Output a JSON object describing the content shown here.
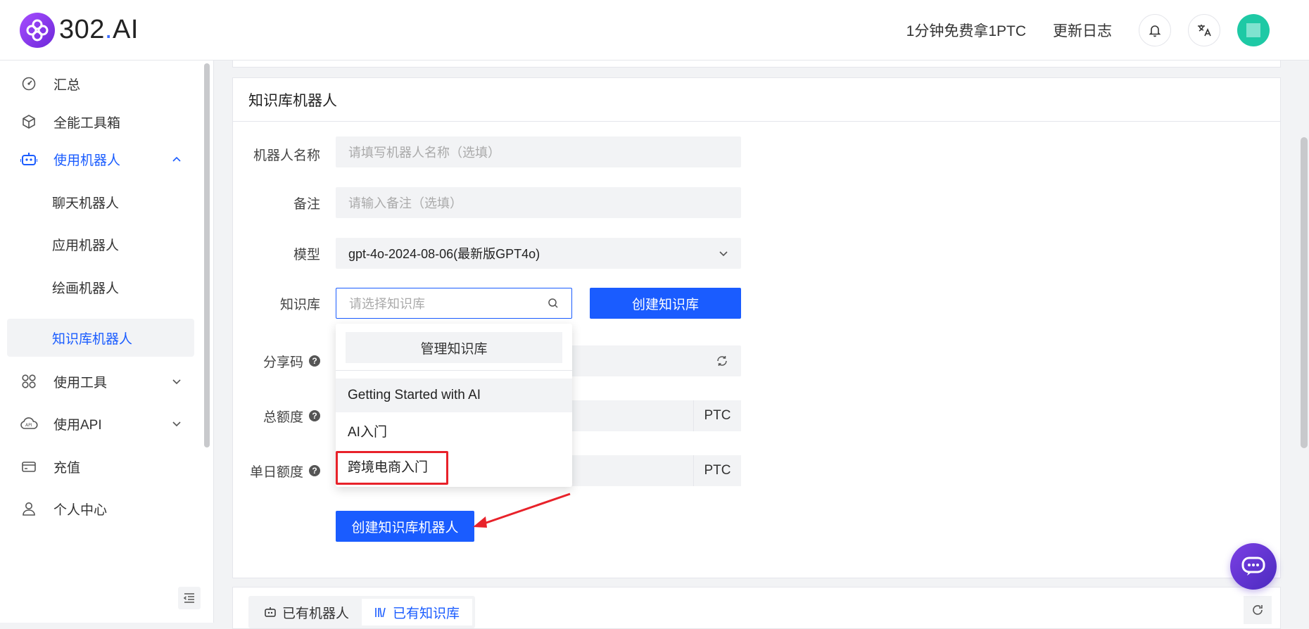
{
  "header": {
    "brand": "302",
    "brand_dot": ".",
    "brand_suffix": "AI",
    "promo_link": "1分钟免费拿1PTC",
    "changelog_link": "更新日志",
    "icons": [
      "bell-icon",
      "translate-icon"
    ]
  },
  "sidebar": {
    "items": [
      {
        "label": "汇总",
        "icon": "dashboard-icon"
      },
      {
        "label": "全能工具箱",
        "icon": "cube-icon"
      },
      {
        "label": "使用机器人",
        "icon": "robot-icon",
        "expanded": true
      },
      {
        "label": "聊天机器人"
      },
      {
        "label": "应用机器人"
      },
      {
        "label": "绘画机器人"
      },
      {
        "label": "知识库机器人",
        "selected": true
      },
      {
        "label": "使用工具",
        "icon": "grid-icon"
      },
      {
        "label": "使用API",
        "icon": "cloud-api-icon"
      },
      {
        "label": "充值",
        "icon": "card-icon"
      },
      {
        "label": "个人中心",
        "icon": "user-icon"
      }
    ]
  },
  "form": {
    "title": "知识库机器人",
    "name_label": "机器人名称",
    "name_placeholder": "请填写机器人名称（选填）",
    "remark_label": "备注",
    "remark_placeholder": "请输入备注（选填）",
    "model_label": "模型",
    "model_value": "gpt-4o-2024-08-06(最新版GPT4o)",
    "kb_label": "知识库",
    "kb_placeholder": "请选择知识库",
    "create_kb_button": "创建知识库",
    "share_label": "分享码",
    "total_label": "总额度",
    "total_suffix": "PTC",
    "daily_label": "单日额度",
    "daily_suffix": "PTC",
    "submit_button": "创建知识库机器人"
  },
  "dropdown": {
    "manage_button": "管理知识库",
    "options": [
      "Getting Started with AI",
      "AI入门",
      "跨境电商入门"
    ],
    "hovered_index": 0,
    "highlighted_index": 2
  },
  "bottom": {
    "tabs": [
      {
        "label": "已有机器人",
        "icon": "robot-icon"
      },
      {
        "label": "已有知识库",
        "icon": "books-icon",
        "active": true
      }
    ]
  },
  "colors": {
    "primary": "#1a5cff",
    "highlight": "#e8222a",
    "brand_purple": "#8b3dff"
  }
}
